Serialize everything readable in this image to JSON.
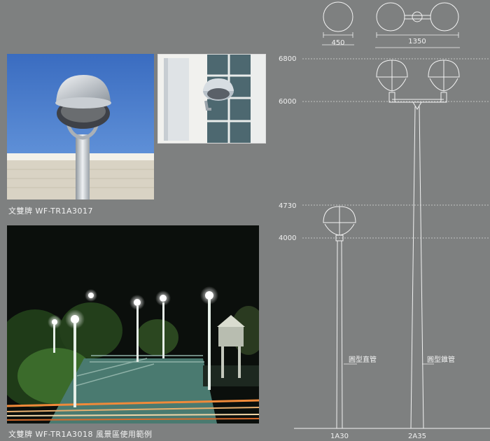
{
  "captions": {
    "photo_1": "文雙牌 WF-TR1A3017",
    "photo_2": "文雙牌 WF-TR1A3018 風景區使用範例"
  },
  "drawing": {
    "top_widths": [
      "450",
      "1350"
    ],
    "heights": [
      "6800",
      "6000",
      "4730",
      "4000"
    ],
    "pole_labels": [
      "圓型直管",
      "圓型錐管"
    ],
    "model_codes": [
      "1A30",
      "2A35"
    ]
  },
  "colors": {
    "background": "#7e8080",
    "sky": "#3c6fc2",
    "line": "#f2f2f2"
  }
}
